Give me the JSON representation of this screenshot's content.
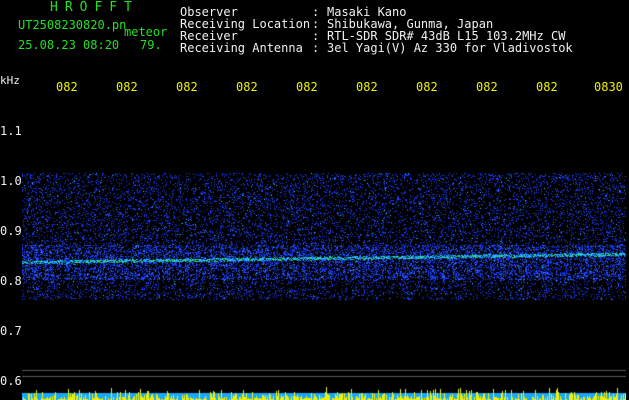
{
  "header": {
    "title": "HROFFT",
    "file": "UT2508230820.pn",
    "meteor": "meteor",
    "date_time": "25.08.23 08:20",
    "count": "79."
  },
  "info": [
    {
      "key": "Observer",
      "value": "Masaki Kano"
    },
    {
      "key": "Receiving Location",
      "value": "Shibukawa, Gunma, Japan"
    },
    {
      "key": "Receiver",
      "value": "RTL-SDR SDR# 43dB L15 103.2MHz CW"
    },
    {
      "key": "Receiving Antenna",
      "value": "3el Yagi(V) Az 330 for Vladivostok"
    }
  ],
  "axis": {
    "y_unit": "kHz",
    "x_ticks": [
      "082",
      "082",
      "082",
      "082",
      "082",
      "082",
      "082",
      "082",
      "082",
      "0830"
    ],
    "y_ticks": [
      "1.1",
      "1.0",
      "0.9",
      "0.8",
      "0.7",
      "0.6"
    ]
  },
  "colors": {
    "background": "#000000",
    "header_green": "#22e022",
    "header_white": "#f0f0f0",
    "tick_yellow": "#f0f000",
    "noise_blue": "#1a3cff",
    "signal_cyan": "#22c8ff",
    "signal_green": "#22ee66",
    "bar_yellow": "#f0f000"
  }
}
